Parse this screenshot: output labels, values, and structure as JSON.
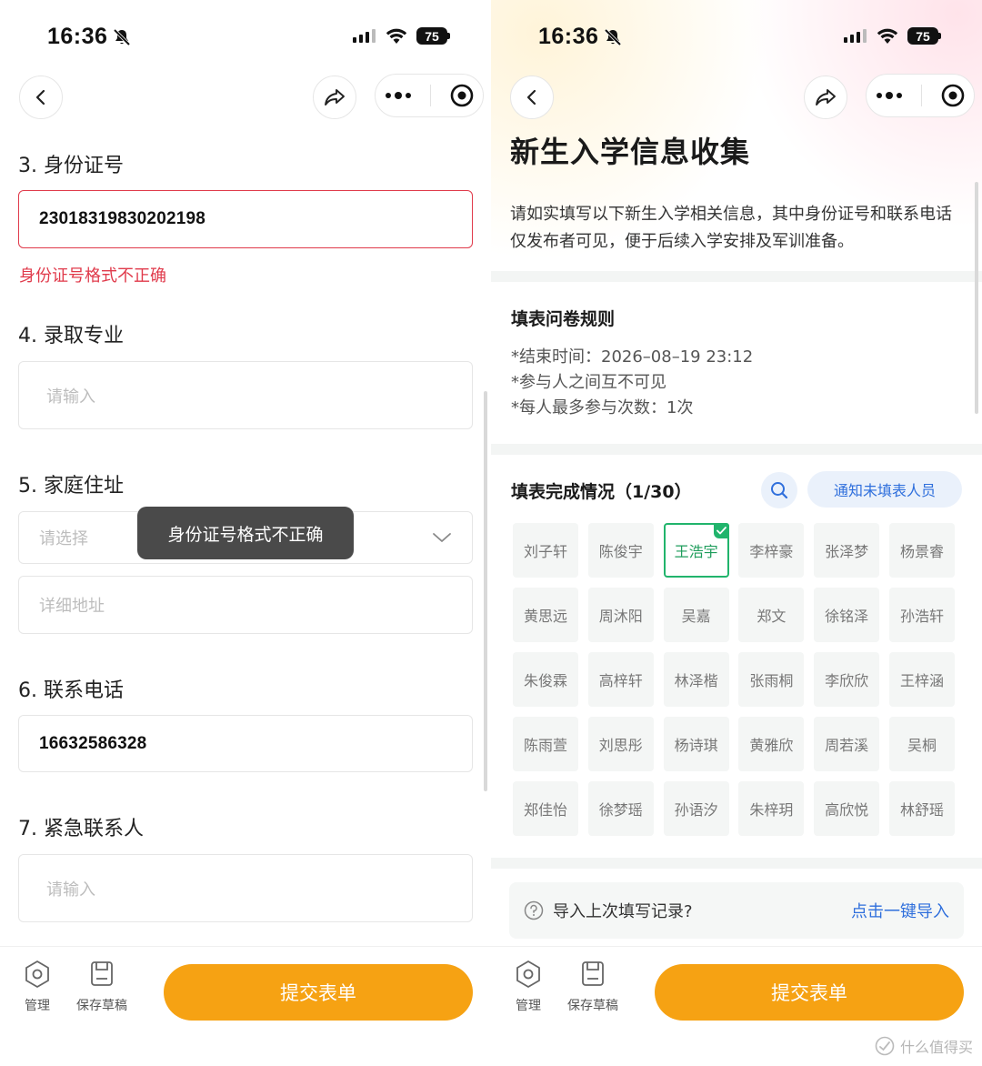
{
  "status_bar": {
    "time": "16:36",
    "battery": "75"
  },
  "left": {
    "questions": [
      {
        "label": "3. 身份证号",
        "value": "23018319830202198",
        "error": "身份证号格式不正确"
      },
      {
        "label": "4. 录取专业",
        "placeholder": "请输入"
      },
      {
        "label": "5. 家庭住址",
        "select_placeholder": "请选择",
        "detail_placeholder": "详细地址"
      },
      {
        "label": "6. 联系电话",
        "value": "16632586328"
      },
      {
        "label": "7. 紧急联系人",
        "placeholder": "请输入"
      }
    ],
    "toast": "身份证号格式不正确"
  },
  "right": {
    "title": "新生入学信息收集",
    "description": "请如实填写以下新生入学相关信息，其中身份证号和联系电话仅发布者可见，便于后续入学安排及军训准备。",
    "rules": {
      "title": "填表问卷规则",
      "items": [
        "*结束时间：2026–08–19 23:12",
        "*参与人之间互不可见",
        "*每人最多参与次数：1次"
      ]
    },
    "completion": {
      "title": "填表完成情况（1/30）",
      "notify_label": "通知未填表人员",
      "names": [
        "刘子轩",
        "陈俊宇",
        "王浩宇",
        "李梓豪",
        "张泽梦",
        "杨景睿",
        "黄思远",
        "周沐阳",
        "吴嘉",
        "郑文",
        "徐铭泽",
        "孙浩轩",
        "朱俊霖",
        "高梓轩",
        "林泽楷",
        "张雨桐",
        "李欣欣",
        "王梓涵",
        "陈雨萱",
        "刘思彤",
        "杨诗琪",
        "黄雅欣",
        "周若溪",
        "吴桐",
        "郑佳怡",
        "徐梦瑶",
        "孙语汐",
        "朱梓玥",
        "高欣悦",
        "林舒瑶"
      ],
      "done_index": 2
    },
    "import": {
      "question": "导入上次填写记录?",
      "link": "点击一键导入"
    }
  },
  "bottom_bar": {
    "manage_label": "管理",
    "draft_label": "保存草稿",
    "submit_label": "提交表单"
  },
  "watermark": "什么值得买",
  "colors": {
    "accent_orange": "#f6a213",
    "error_red": "#e03a4b",
    "success_green": "#21b46c",
    "link_blue": "#2f6fdc"
  }
}
